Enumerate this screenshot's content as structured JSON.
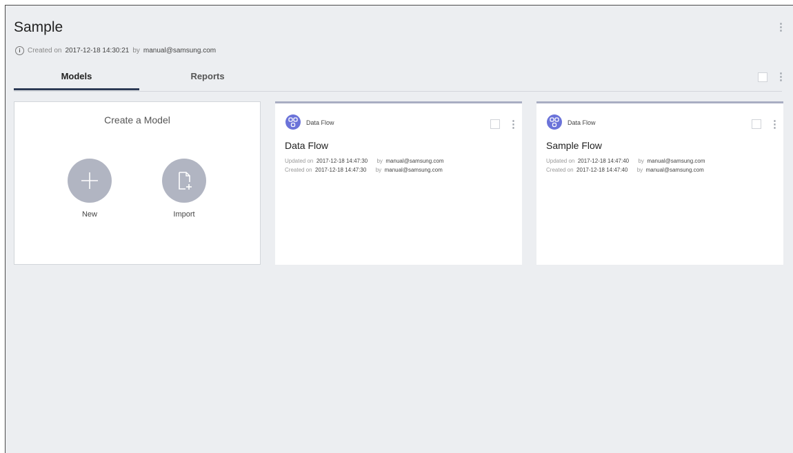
{
  "page": {
    "title": "Sample",
    "created_label": "Created on",
    "created_date": "2017-12-18 14:30:21",
    "by_label": "by",
    "created_by": "manual@samsung.com"
  },
  "tabs": [
    {
      "label": "Models",
      "active": true
    },
    {
      "label": "Reports",
      "active": false
    }
  ],
  "create_card": {
    "title": "Create a Model",
    "new_label": "New",
    "import_label": "Import"
  },
  "models": [
    {
      "type": "Data Flow",
      "title": "Data Flow",
      "updated_label": "Updated on",
      "updated_date": "2017-12-18 14:47:30",
      "updated_by": "manual@samsung.com",
      "created_label": "Created on",
      "created_date": "2017-12-18 14:47:30",
      "created_by": "manual@samsung.com",
      "by_label": "by"
    },
    {
      "type": "Data Flow",
      "title": "Sample Flow",
      "updated_label": "Updated on",
      "updated_date": "2017-12-18 14:47:40",
      "updated_by": "manual@samsung.com",
      "created_label": "Created on",
      "created_date": "2017-12-18 14:47:40",
      "created_by": "manual@samsung.com",
      "by_label": "by"
    }
  ],
  "icons": {
    "info": "info-icon",
    "more": "kebab-menu-icon",
    "new": "plus-icon",
    "import": "import-file-icon",
    "model": "data-flow-icon"
  },
  "colors": {
    "tab_active": "#2c3a55",
    "card_accent": "#a8adc2",
    "model_icon": "#6b73d9",
    "circle_button": "#b1b5c2"
  }
}
